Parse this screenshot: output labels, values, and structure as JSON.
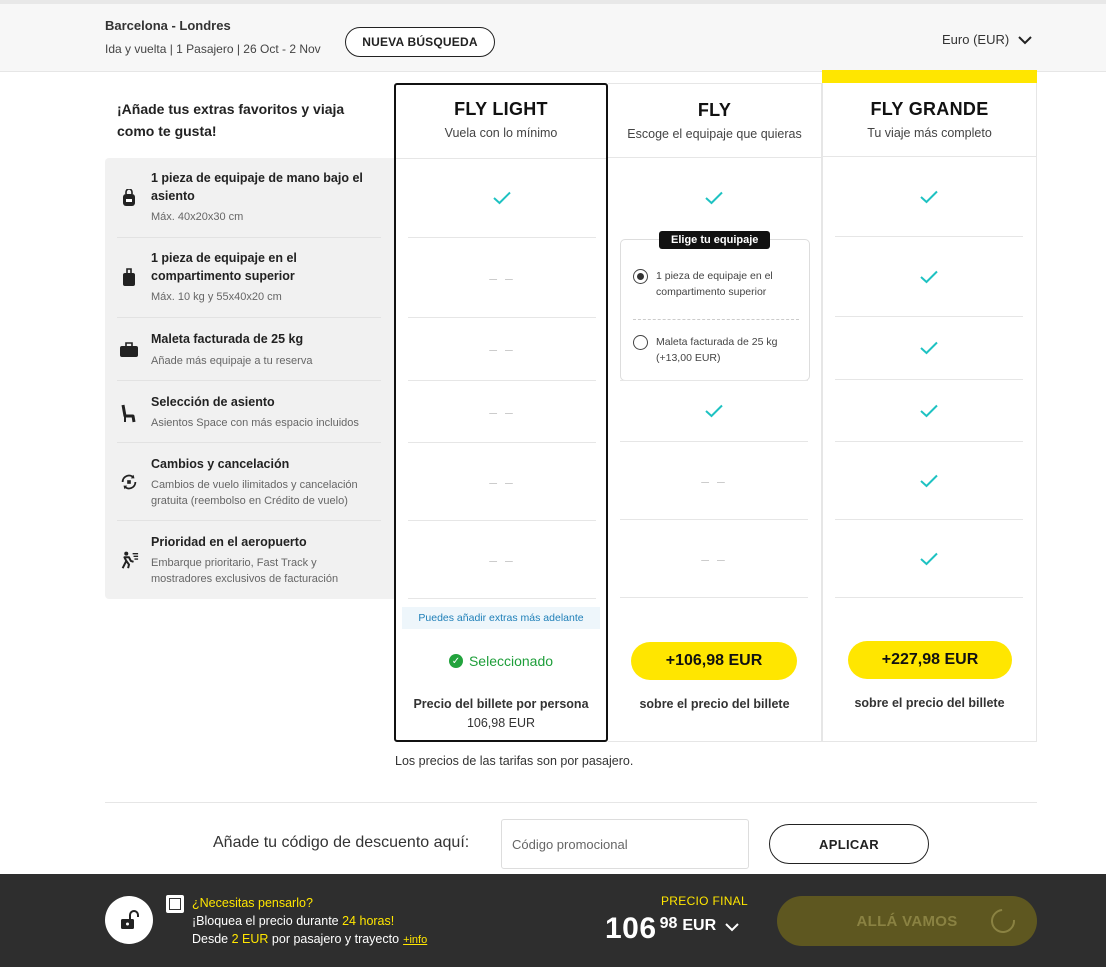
{
  "header": {
    "route": "Barcelona - Londres",
    "details": "Ida y vuelta | 1 Pasajero | 26 Oct - 2 Nov",
    "new_search": "NUEVA BÚSQUEDA",
    "currency": "Euro (EUR)"
  },
  "intro": "¡Añade tus extras favoritos y viaja como te gusta!",
  "features": [
    {
      "title": "1 pieza de equipaje de mano bajo el asiento",
      "sub": "Máx. 40x20x30 cm",
      "icon": "backpack-icon"
    },
    {
      "title": "1 pieza de equipaje en el compartimento superior",
      "sub": "Máx. 10 kg y 55x40x20 cm",
      "icon": "trolley-icon"
    },
    {
      "title": "Maleta facturada de 25 kg",
      "sub": "Añade más equipaje a tu reserva",
      "icon": "suitcase-icon"
    },
    {
      "title": "Selección de asiento",
      "sub": "Asientos Space con más espacio incluidos",
      "icon": "seat-icon"
    },
    {
      "title": "Cambios y cancelación",
      "sub": "Cambios de vuelo ilimitados y cancelación gratuita (reembolso en Crédito de vuelo)",
      "icon": "change-icon"
    },
    {
      "title": "Prioridad en el aeropuerto",
      "sub": "Embarque prioritario, Fast Track y mostradores exclusivos de facturación",
      "icon": "priority-icon"
    }
  ],
  "fares": [
    {
      "name": "FLY LIGHT",
      "desc": "Vuela con lo mínimo",
      "note": "Puedes añadir extras más adelante",
      "status": "Seleccionado",
      "price_label": "Precio del billete por persona",
      "price": "106,98  EUR",
      "dash": "– –"
    },
    {
      "name": "FLY",
      "desc": "Escoge el equipaje que quieras",
      "price": "+106,98  EUR",
      "price_label": "sobre el precio del billete",
      "chooser": {
        "tag": "Elige tu equipaje",
        "opt1": "1 pieza de equipaje en el compartimento superior",
        "opt2": "Maleta facturada de 25 kg (+13,00 EUR)"
      }
    },
    {
      "name": "FLY GRANDE",
      "desc": "Tu viaje más completo",
      "price": "+227,98  EUR",
      "price_label": "sobre el precio del billete"
    }
  ],
  "footnote": "Los precios de las tarifas son por pasajero.",
  "discount": {
    "label": "Añade tu código de descuento aquí:",
    "placeholder": "Código promocional",
    "apply": "APLICAR"
  },
  "bottom": {
    "hold_title": "¿Necesitas pensarlo?",
    "hold_line1_a": "¡Bloquea el precio durante ",
    "hold_line1_b": "24 horas!",
    "hold_line2_a": "Desde ",
    "hold_line2_b": "2 EUR",
    "hold_line2_c": " por pasajero y trayecto",
    "info": "+info",
    "final_label": "PRECIO FINAL",
    "final_int": "106",
    "final_dec": "98",
    "final_cur": "EUR",
    "go": "ALLÁ VAMOS"
  },
  "colors": {
    "accent": "#ffe600",
    "check": "#1ec2c2",
    "selected": "#1e9e3a",
    "dark": "#2e2e2e"
  }
}
